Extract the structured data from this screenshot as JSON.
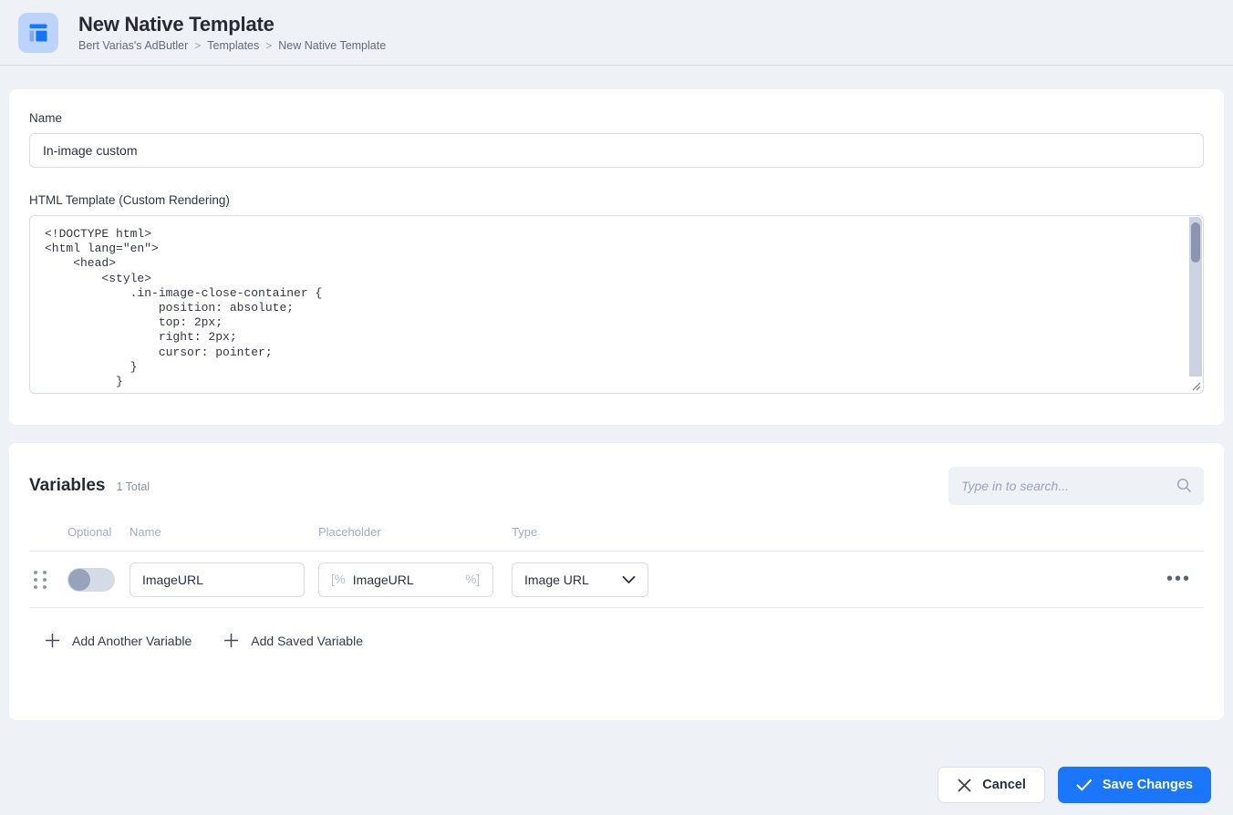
{
  "header": {
    "icon": "template-layout-icon",
    "title": "New Native Template",
    "breadcrumb": [
      "Bert Varias's AdButler",
      "Templates",
      "New Native Template"
    ],
    "breadcrumb_separator": ">"
  },
  "form": {
    "name_label": "Name",
    "name_value": "In-image custom",
    "html_label": "HTML Template (Custom Rendering)",
    "html_value": "<!DOCTYPE html>\n<html lang=\"en\">\n    <head>\n        <style>\n            .in-image-close-container {\n                position: absolute;\n                top: 2px;\n                right: 2px;\n                cursor: pointer;\n            }\n          }"
  },
  "variables": {
    "title": "Variables",
    "count_label": "1 Total",
    "search": {
      "placeholder": "Type in to search...",
      "value": "",
      "icon": "search-icon"
    },
    "columns": {
      "optional": "Optional",
      "name": "Name",
      "placeholder": "Placeholder",
      "type": "Type"
    },
    "rows": [
      {
        "optional_on": false,
        "name": "ImageURL",
        "placeholder_open": "[%",
        "placeholder_text": "ImageURL",
        "placeholder_close": "%]",
        "type": "Image URL",
        "menu_icon": "ellipsis-icon"
      }
    ],
    "add_another_label": "Add Another Variable",
    "add_saved_label": "Add Saved Variable"
  },
  "footer": {
    "cancel_label": "Cancel",
    "save_label": "Save Changes"
  },
  "colors": {
    "accent": "#1a77fc",
    "page_bg": "#eef1f5",
    "card_bg": "#ffffff",
    "icon_tile": "#bed3fb"
  }
}
